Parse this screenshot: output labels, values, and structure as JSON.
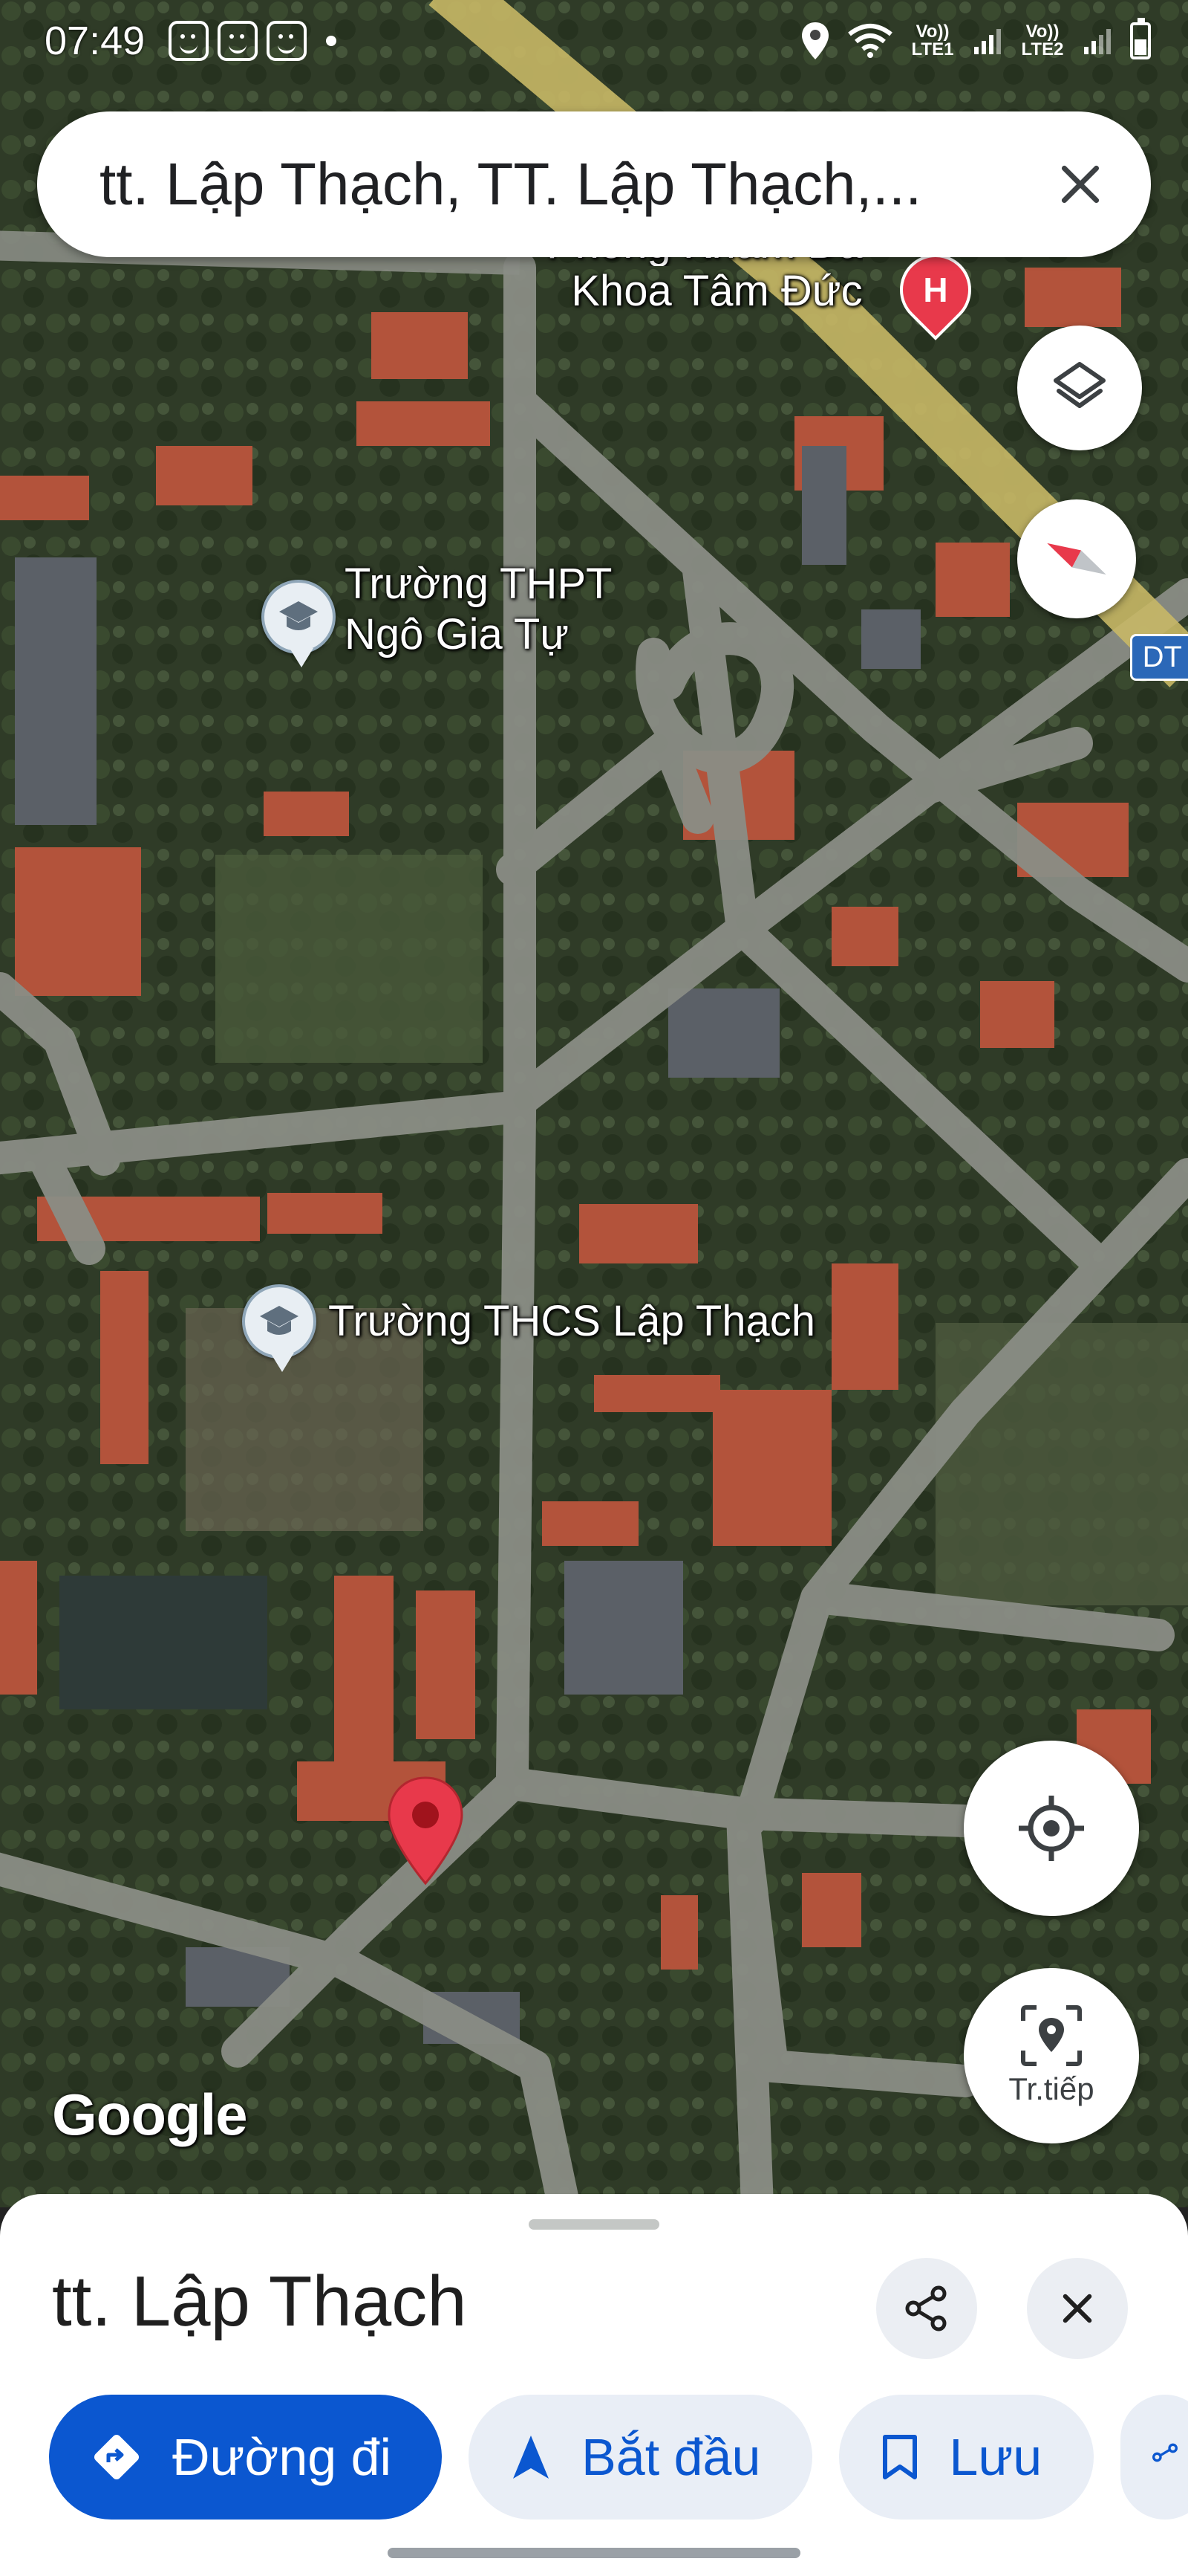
{
  "status_bar": {
    "time": "07:49",
    "network_1": "Vo)) LTE1",
    "network_2": "Vo)) LTE2",
    "icons": [
      "emoji-face-icon",
      "emoji-face-icon",
      "emoji-face-icon",
      "location-icon",
      "wifi-icon",
      "signal-icon",
      "battery-icon"
    ]
  },
  "search": {
    "query": "tt. Lập Thạch, TT. Lập Thạch,..."
  },
  "map": {
    "labels": {
      "clinic": "Phòng Khám Đa Khoa Tâm Đức",
      "clinic_line1": "Phòng Khám Đa",
      "clinic_line2": "Khoa Tâm Đức",
      "high_school_line1": "Trường THPT",
      "high_school_line2": "Ngô Gia Tự",
      "middle_school": "Trường THCS Lập Thạch",
      "road_badge": "DT"
    },
    "hospital_symbol": "H",
    "attribution": "Google"
  },
  "controls": {
    "live_label": "Tr.tiếp"
  },
  "sheet": {
    "title": "tt. Lập Thạch",
    "actions": [
      {
        "label": "Đường đi",
        "icon": "directions-icon",
        "primary": true
      },
      {
        "label": "Bắt đầu",
        "icon": "navigation-arrow-icon",
        "primary": false
      },
      {
        "label": "Lưu",
        "icon": "bookmark-icon",
        "primary": false
      }
    ]
  },
  "colors": {
    "accent": "#0b57d0",
    "chip_bg": "#e9eef6",
    "marker_red": "#e8394b",
    "road": "#8a8d85"
  }
}
